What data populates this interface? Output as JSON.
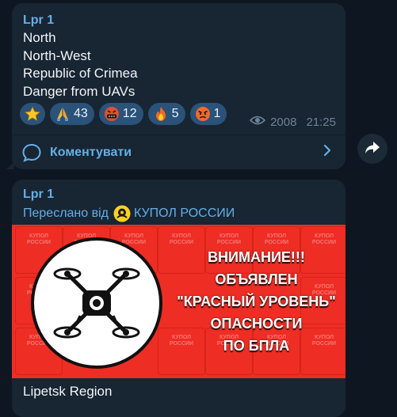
{
  "messages": [
    {
      "author": "Lpr 1",
      "lines": [
        "North",
        "North-West",
        "Republic of Crimea",
        "Danger from UAVs"
      ],
      "reactions": [
        {
          "icon": "star-icon",
          "count": ""
        },
        {
          "icon": "praying-hands-icon",
          "count": "43"
        },
        {
          "icon": "cursing-face-icon",
          "count": "12"
        },
        {
          "icon": "fire-icon",
          "count": "5"
        },
        {
          "icon": "angry-face-icon",
          "count": "1"
        }
      ],
      "views": "2008",
      "time": "21:25",
      "comments_label": "Коментувати"
    },
    {
      "author": "Lpr 1",
      "forwarded_prefix": "Переслано від",
      "forwarded_source": "КУПОЛ РОССИИ",
      "banner": {
        "warning_lines": [
          "ВНИМАНИЕ!!!",
          "ОБЪЯВЛЕН",
          "\"КРАСНЫЙ УРОВЕНЬ\"",
          "ОПАСНОСТИ",
          "ПО БПЛА"
        ],
        "background_color": "#ee2d24"
      },
      "caption": "Lipetsk Region"
    }
  ],
  "colors": {
    "bubble": "#182533",
    "accent": "#64b0e8",
    "background": "#0e1621"
  }
}
